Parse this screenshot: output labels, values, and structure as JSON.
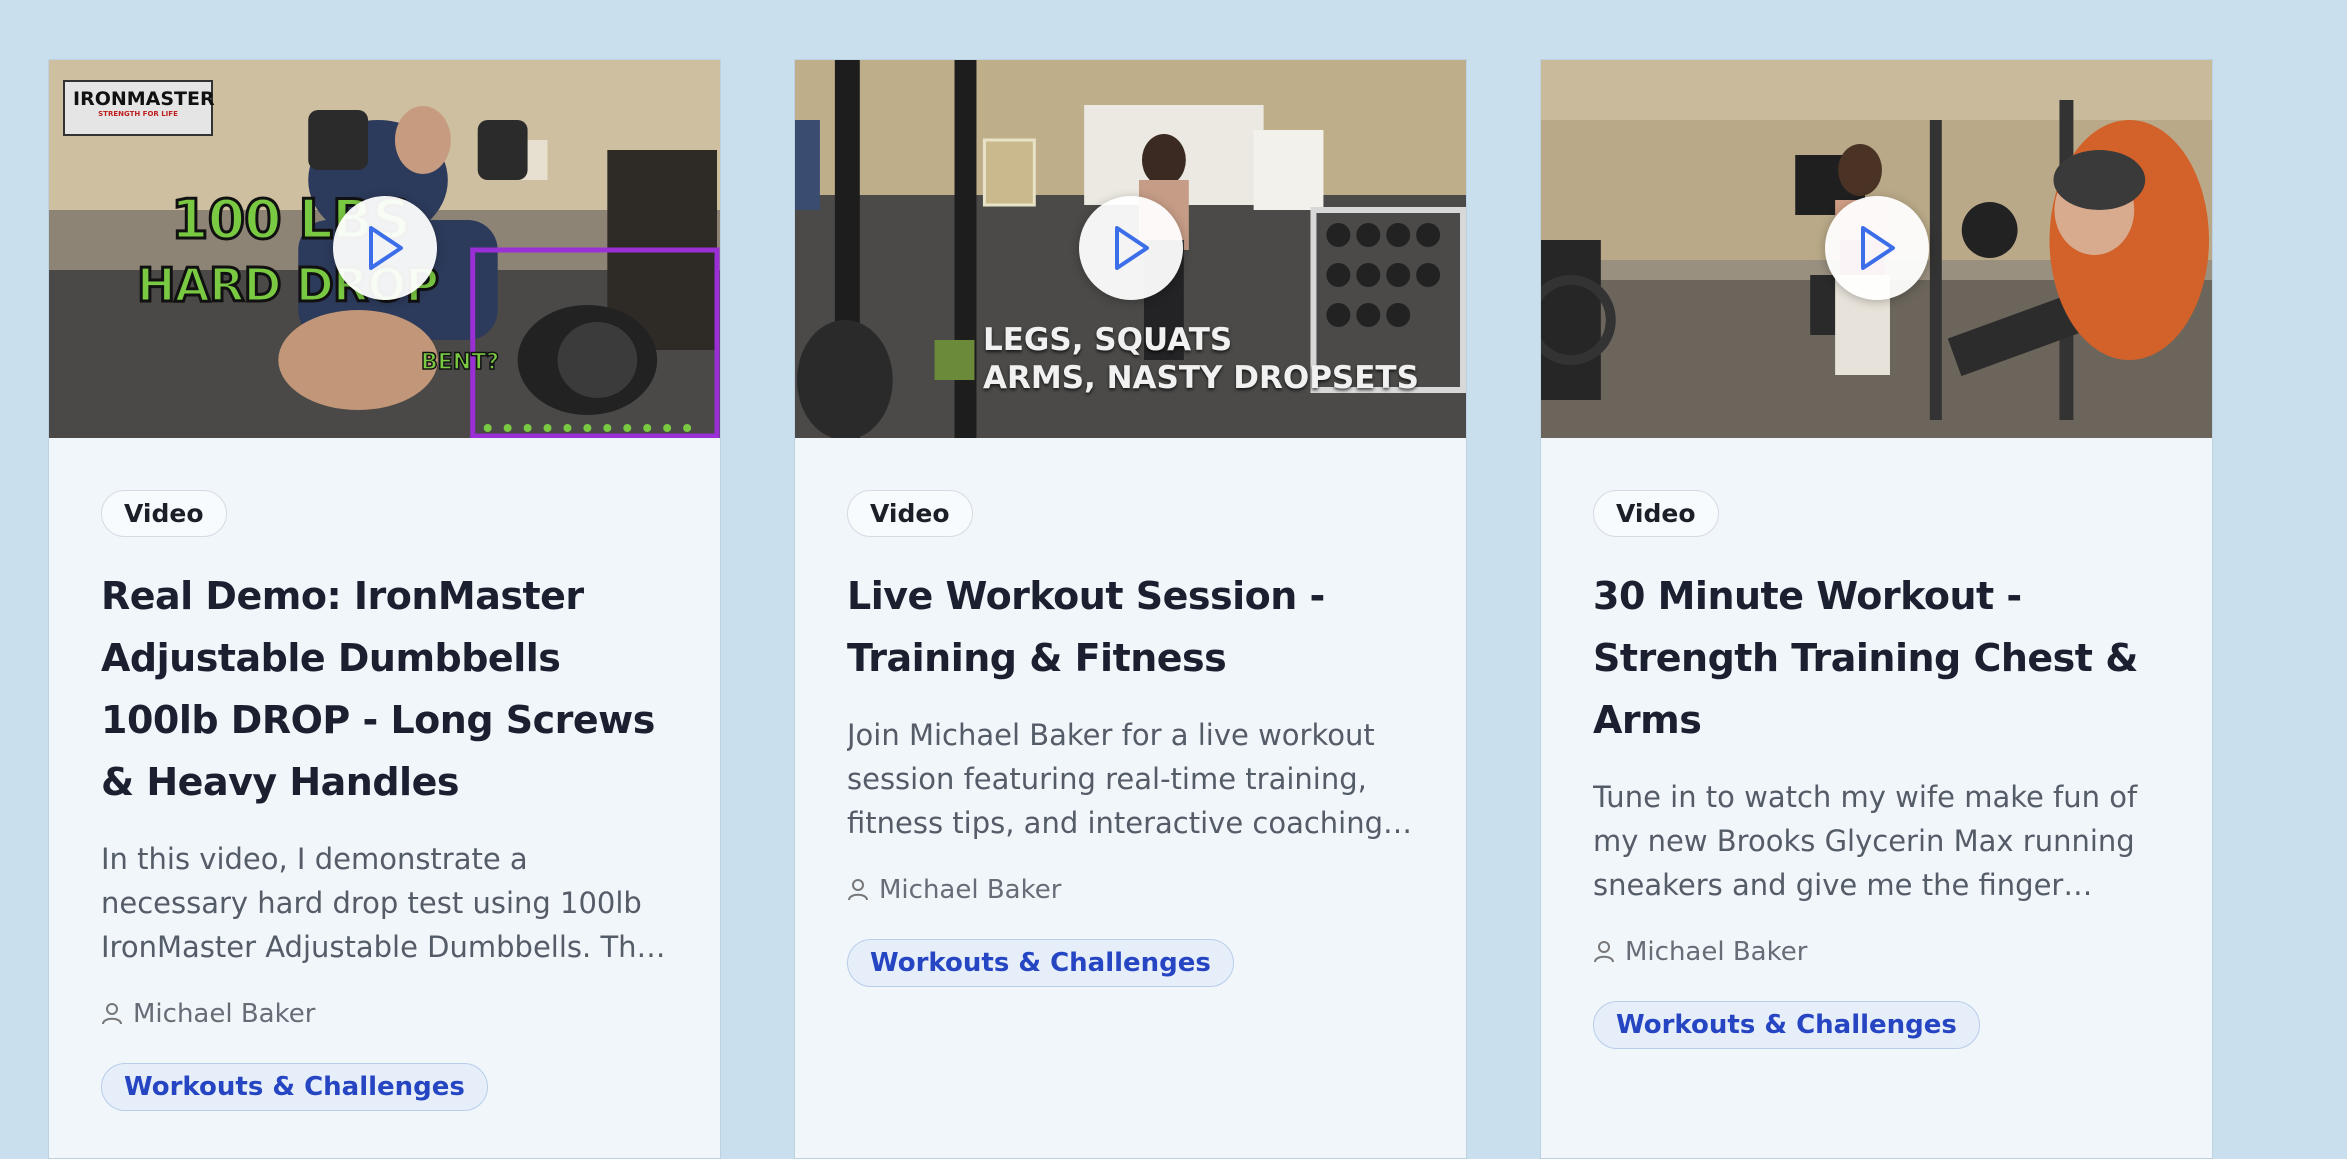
{
  "cards": [
    {
      "badge": "Video",
      "title": "Real Demo: IronMaster Adjustable Dumbbells 100lb DROP - Long Screws & Heavy Handles",
      "description": "In this video, I demonstrate a necessary hard drop test using 100lb IronMaster Adjustable Dumbbells. This video will show you how the screws and handles held up after the drop.",
      "author": "Michael Baker",
      "category": "Workouts & Challenges",
      "thumbnail": {
        "logo": "IRONMASTER",
        "logo_tagline": "STRENGTH FOR LIFE",
        "line1": "100 LBS",
        "line2": "HARD DROP",
        "tag": "BENT?"
      }
    },
    {
      "badge": "Video",
      "title": "Live Workout Session - Training & Fitness",
      "description": "Join Michael Baker for a live workout session featuring real-time training, fitness tips, and interactive coaching with the community.",
      "author": "Michael Baker",
      "category": "Workouts & Challenges",
      "thumbnail": {
        "line1": "LEGS, SQUATS",
        "line2": "ARMS, NASTY DROPSETS"
      }
    },
    {
      "badge": "Video",
      "title": "30 Minute Workout - Strength Training Chest & Arms",
      "description": "Tune in to watch my wife make fun of my new Brooks Glycerin Max running sneakers and give me the finger during our thirty minute strength session.",
      "author": "Michael Baker",
      "category": "Workouts & Challenges",
      "thumbnail": {}
    }
  ],
  "icons": {
    "play": "play-icon",
    "author": "person-icon"
  },
  "colors": {
    "page_bg": "#c9dfee",
    "card_bg": "#f1f6fb",
    "accent": "#3b6ee8",
    "category_text": "#2545c3",
    "overlay_green": "#7ac943",
    "overlay_purple": "#9b2fd6"
  }
}
